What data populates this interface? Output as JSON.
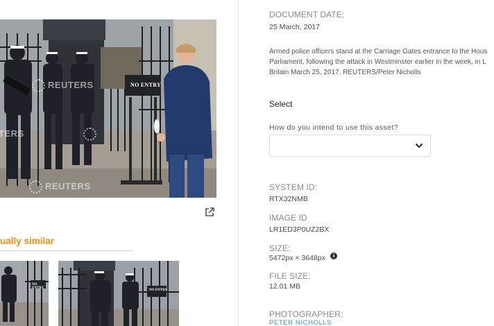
{
  "photo": {
    "sign_text": "NO ENTRY",
    "watermark_text": "REUTERS",
    "watermark_partial_text": "TERS"
  },
  "similar": {
    "heading": "ually similar",
    "thumb_sign_text": "NO ENTRY"
  },
  "details": {
    "document_date_label": "DOCUMENT DATE:",
    "document_date_value": "25 March, 2017",
    "caption_lines": [
      "Armed police officers stand at the Carriage Gates entrance to the Hous",
      "Parliament, following the attack in Westminster earlier in the week, in L",
      "Britain March 25, 2017. REUTERS/Peter Nicholls"
    ],
    "select_title": "Select",
    "usage_question": "How do you intend to use this asset?",
    "usage_selected": "",
    "system_id_label": "SYSTEM ID:",
    "system_id_value": "RTX32NMB",
    "image_id_label": "IMAGE ID",
    "image_id_value": "LR1ED3P0UZ2BX",
    "size_label": "SIZE:",
    "size_value": "5472px × 3648px",
    "file_size_label": "FILE SIZE:",
    "file_size_value": "12.01 MB",
    "photographer_label": "PHOTOGRAPHER:",
    "photographer_value": "PETER NICHOLLS"
  },
  "colors": {
    "accent_orange": "#f28c0f",
    "link_blue": "#3c8fd6"
  },
  "icons": [
    "open-external-icon",
    "chevron-down-icon",
    "info-icon",
    "reuters-logo-icon"
  ]
}
